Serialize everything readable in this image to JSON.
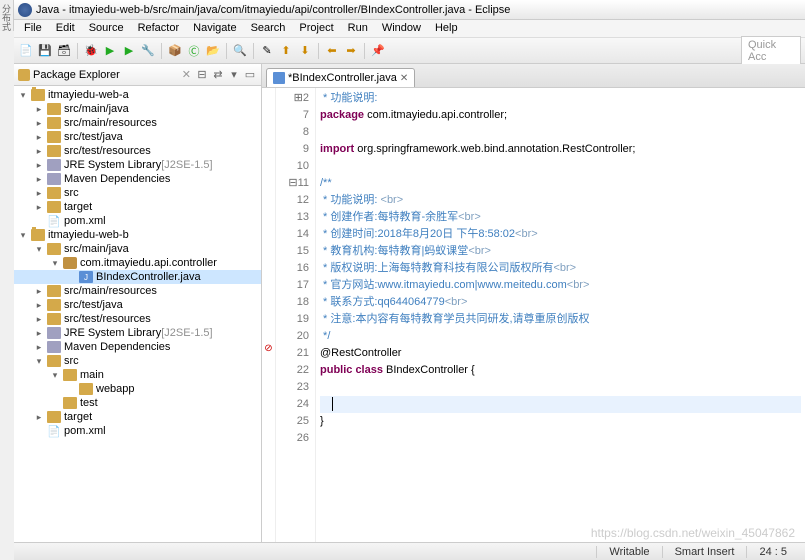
{
  "window": {
    "title": "Java - itmayiedu-web-b/src/main/java/com/itmayiedu/api/controller/BIndexController.java - Eclipse"
  },
  "menu": [
    "File",
    "Edit",
    "Source",
    "Refactor",
    "Navigate",
    "Search",
    "Project",
    "Run",
    "Window",
    "Help"
  ],
  "quick_access_placeholder": "Quick Acc",
  "explorer": {
    "title": "Package Explorer",
    "tree": [
      {
        "d": 0,
        "t": "▾",
        "i": "project",
        "l": "itmayiedu-web-a"
      },
      {
        "d": 1,
        "t": "▸",
        "i": "folder",
        "l": "src/main/java"
      },
      {
        "d": 1,
        "t": "▸",
        "i": "folder",
        "l": "src/main/resources"
      },
      {
        "d": 1,
        "t": "▸",
        "i": "folder",
        "l": "src/test/java"
      },
      {
        "d": 1,
        "t": "▸",
        "i": "folder",
        "l": "src/test/resources"
      },
      {
        "d": 1,
        "t": "▸",
        "i": "jar",
        "l": "JRE System Library",
        "dec": " [J2SE-1.5]"
      },
      {
        "d": 1,
        "t": "▸",
        "i": "jar",
        "l": "Maven Dependencies"
      },
      {
        "d": 1,
        "t": "▸",
        "i": "folder",
        "l": "src"
      },
      {
        "d": 1,
        "t": "▸",
        "i": "folder",
        "l": "target"
      },
      {
        "d": 1,
        "t": "",
        "i": "xml",
        "l": "pom.xml"
      },
      {
        "d": 0,
        "t": "▾",
        "i": "project",
        "l": "itmayiedu-web-b"
      },
      {
        "d": 1,
        "t": "▾",
        "i": "folder",
        "l": "src/main/java"
      },
      {
        "d": 2,
        "t": "▾",
        "i": "package",
        "l": "com.itmayiedu.api.controller"
      },
      {
        "d": 3,
        "t": "",
        "i": "java",
        "l": "BIndexController.java",
        "sel": true
      },
      {
        "d": 1,
        "t": "▸",
        "i": "folder",
        "l": "src/main/resources"
      },
      {
        "d": 1,
        "t": "▸",
        "i": "folder",
        "l": "src/test/java"
      },
      {
        "d": 1,
        "t": "▸",
        "i": "folder",
        "l": "src/test/resources"
      },
      {
        "d": 1,
        "t": "▸",
        "i": "jar",
        "l": "JRE System Library",
        "dec": " [J2SE-1.5]"
      },
      {
        "d": 1,
        "t": "▸",
        "i": "jar",
        "l": "Maven Dependencies"
      },
      {
        "d": 1,
        "t": "▾",
        "i": "folder",
        "l": "src"
      },
      {
        "d": 2,
        "t": "▾",
        "i": "folder",
        "l": "main"
      },
      {
        "d": 3,
        "t": "",
        "i": "folder",
        "l": "webapp"
      },
      {
        "d": 2,
        "t": "",
        "i": "folder",
        "l": "test"
      },
      {
        "d": 1,
        "t": "▸",
        "i": "folder",
        "l": "target"
      },
      {
        "d": 1,
        "t": "",
        "i": "xml",
        "l": "pom.xml"
      }
    ]
  },
  "editor": {
    "tab_label": "*BIndexController.java",
    "gutter_start": 2,
    "lines": [
      {
        "n": "2",
        "fold": "+",
        "cm": " * 功能说明:"
      },
      {
        "n": "7",
        "kw": "package",
        "rest": " com.itmayiedu.api.controller;"
      },
      {
        "n": "8"
      },
      {
        "n": "9",
        "kw": "import",
        "rest": " org.springframework.web.bind.annotation.RestController;"
      },
      {
        "n": "10"
      },
      {
        "n": "11",
        "fold": "-",
        "cm": "/**"
      },
      {
        "n": "12",
        "cm": " * 功能说明: ",
        "tag": "<br>"
      },
      {
        "n": "13",
        "cm": " * 创建作者:每特教育-余胜军",
        "tag": "<br>"
      },
      {
        "n": "14",
        "cm": " * 创建时间:2018年8月20日 下午8:58:02",
        "tag": "<br>"
      },
      {
        "n": "15",
        "cm": " * 教育机构:每特教育|蚂蚁课堂",
        "tag": "<br>"
      },
      {
        "n": "16",
        "cm": " * 版权说明:上海每特教育科技有限公司版权所有",
        "tag": "<br>"
      },
      {
        "n": "17",
        "cm": " * 官方网站:www.itmayiedu.com|www.meitedu.com",
        "tag": "<br>"
      },
      {
        "n": "18",
        "cm": " * 联系方式:qq644064779",
        "tag": "<br>"
      },
      {
        "n": "19",
        "cm": " * 注意:本内容有每特教育学员共同研发,请尊重原创版权"
      },
      {
        "n": "20",
        "cm": " */"
      },
      {
        "n": "21",
        "anno": "@RestController",
        "marker": true
      },
      {
        "n": "22",
        "cls": "public class BIndexController {"
      },
      {
        "n": "23"
      },
      {
        "n": "24",
        "hl": true,
        "cursor": true,
        "indent": "    "
      },
      {
        "n": "25",
        "text": "}"
      },
      {
        "n": "26"
      }
    ]
  },
  "status": {
    "writable": "Writable",
    "insert": "Smart Insert",
    "pos": "24 : 5"
  },
  "watermark": "https://blog.csdn.net/weixin_45047862"
}
